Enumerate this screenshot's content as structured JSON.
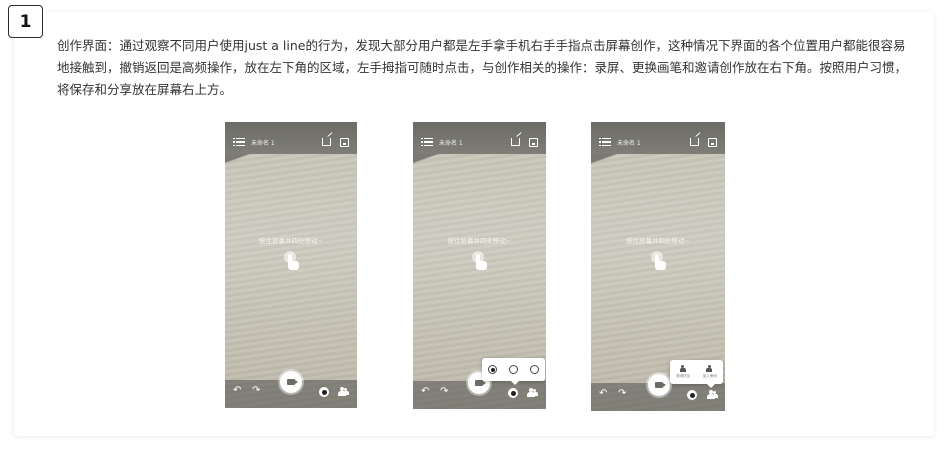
{
  "section_number": "1",
  "description": "创作界面：通过观察不同用户使用just a line的行为，发现大部分用户都是左手拿手机右手手指点击屏幕创作，这种情况下界面的各个位置用户都能很容易地接触到，撤销返回是高频操作，放在左下角的区域，左手拇指可随时点击，与创作相关的操作：录屏、更换画笔和邀请创作放在右下角。按照用户习惯，将保存和分享放在屏幕右上方。",
  "phones": [
    {
      "title": "未命名 1",
      "hint": "按住屏幕并四处移动~"
    },
    {
      "title": "未命名 1",
      "hint": "按住屏幕并四处移动~"
    },
    {
      "title": "未命名 1",
      "hint": "按住屏幕并四处移动~"
    }
  ],
  "invite_popup": {
    "option1": "邀请好友",
    "option2": "加入房间"
  },
  "icons": {
    "menu": "menu-icon",
    "share": "share-icon",
    "save": "save-icon",
    "undo": "undo-icon",
    "redo": "redo-icon",
    "record": "video-camera-icon",
    "pen": "pen-dot-icon",
    "invite": "people-icon",
    "touch": "hand-tap-icon"
  }
}
